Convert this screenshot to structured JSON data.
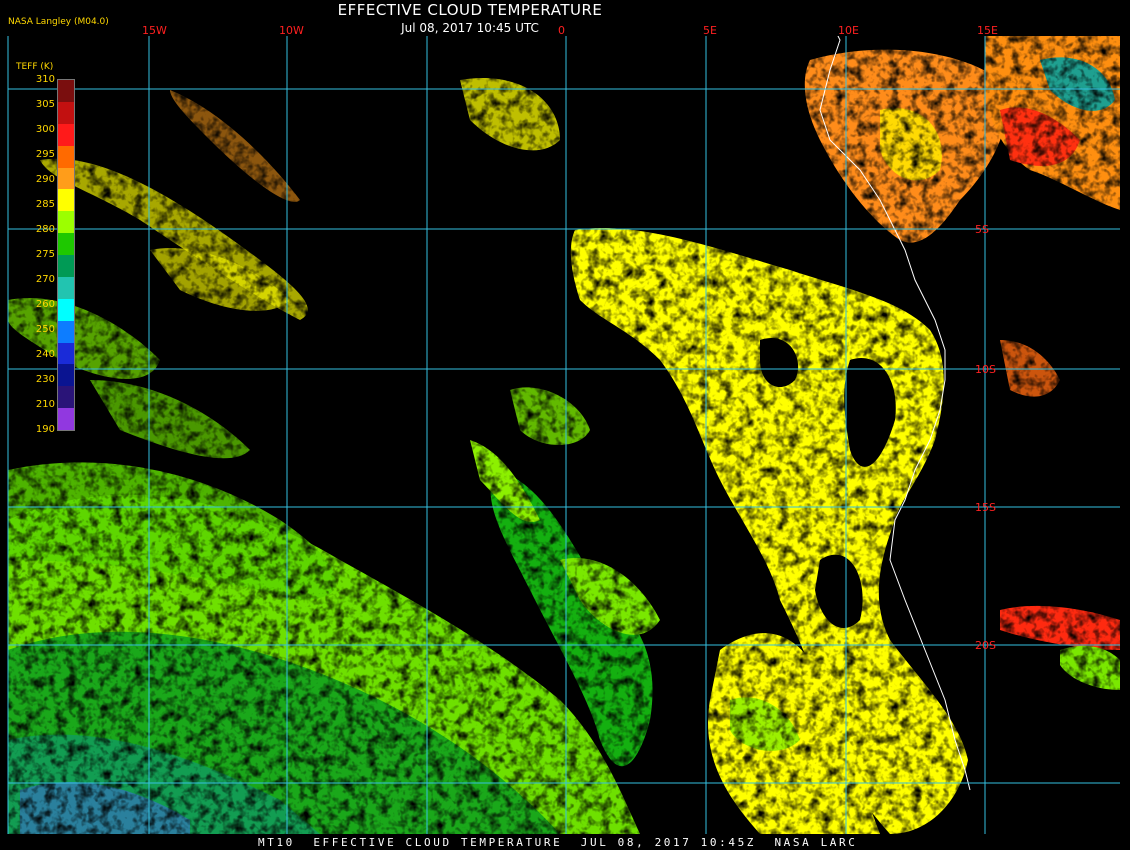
{
  "title": "EFFECTIVE CLOUD TEMPERATURE",
  "subtitle": "Jul 08, 2017 10:45 UTC",
  "source": "NASA Langley (M04.0)",
  "footer": "MT10  EFFECTIVE CLOUD TEMPERATURE  JUL 08, 2017 10:45Z  NASA LARC",
  "legend": {
    "title": "TEFF (K)",
    "ticks": [
      "310",
      "305",
      "300",
      "295",
      "290",
      "285",
      "280",
      "275",
      "270",
      "260",
      "250",
      "240",
      "230",
      "210",
      "190"
    ],
    "colors": [
      "#7a0e0e",
      "#c21010",
      "#ff1a1a",
      "#ff6a00",
      "#ff9d1a",
      "#ffff00",
      "#9cff00",
      "#1ec800",
      "#009a55",
      "#22c4b0",
      "#00ffff",
      "#0d7dff",
      "#1a2bd8",
      "#0a1491",
      "#2a1478",
      "#9138e0"
    ]
  },
  "grid_labels": {
    "top": [
      "15W",
      "10W",
      "0",
      "5E",
      "10E",
      "15E"
    ],
    "right": [
      "5S",
      "10S",
      "15S",
      "20S"
    ]
  },
  "colors": {
    "grid": "#35c0e0",
    "label": "#ff2020",
    "background": "#000000",
    "coastline": "#ffffff"
  }
}
